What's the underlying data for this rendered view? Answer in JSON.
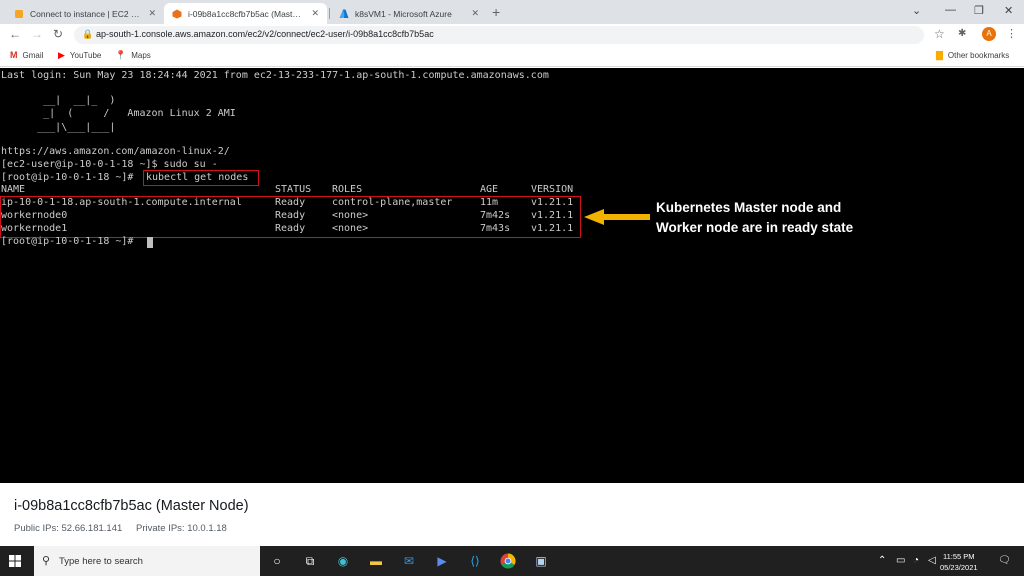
{
  "browser": {
    "tabs": [
      {
        "title": "Connect to instance | EC2 Manag",
        "active": false,
        "icon": "aws-cube-icon"
      },
      {
        "title": "i-09b8a1cc8cfb7b5ac (Master Nc",
        "active": true,
        "icon": "aws-cube-icon"
      },
      {
        "title": "k8sVM1 - Microsoft Azure",
        "active": false,
        "icon": "azure-icon"
      }
    ],
    "url": "ap-south-1.console.aws.amazon.com/ec2/v2/connect/ec2-user/i-09b8a1cc8cfb7b5ac",
    "profile_initial": "A",
    "bookmarks": [
      "Gmail",
      "YouTube",
      "Maps"
    ],
    "other_bookmarks": "Other bookmarks"
  },
  "terminal": {
    "last_login": "Last login: Sun May 23 18:24:44 2021 from ec2-13-233-177-1.ap-south-1.compute.amazonaws.com",
    "banner": [
      "       __|  __|_  )",
      "       _|  (     /   Amazon Linux 2 AMI",
      "      ___|\\___|___|"
    ],
    "url_line": "https://aws.amazon.com/amazon-linux-2/",
    "cmd1": "[ec2-user@ip-10-0-1-18 ~]$ sudo su -",
    "prompt": "[root@ip-10-0-1-18 ~]# ",
    "cmd2": "kubectl get nodes",
    "headers": [
      "NAME",
      "STATUS",
      "ROLES",
      "AGE",
      "VERSION"
    ],
    "rows": [
      [
        "ip-10-0-1-18.ap-south-1.compute.internal",
        "Ready",
        "control-plane,master",
        "11m",
        "v1.21.1"
      ],
      [
        "workernode0",
        "Ready",
        "<none>",
        "7m42s",
        "v1.21.1"
      ],
      [
        "workernode1",
        "Ready",
        "<none>",
        "7m43s",
        "v1.21.1"
      ]
    ],
    "final_prompt": "[root@ip-10-0-1-18 ~]# "
  },
  "annotation": {
    "line1": "Kubernetes Master node and",
    "line2": "Worker node are in ready state",
    "arrow_color": "#f0b400",
    "box_color": "#d0101a"
  },
  "instance": {
    "title": "i-09b8a1cc8cfb7b5ac (Master Node)",
    "public_ips": "Public IPs: 52.66.181.141",
    "private_ips": "Private IPs: 10.0.1.18"
  },
  "taskbar": {
    "search_placeholder": "Type here to search",
    "time": "11:55 PM",
    "date": "05/23/2021"
  }
}
